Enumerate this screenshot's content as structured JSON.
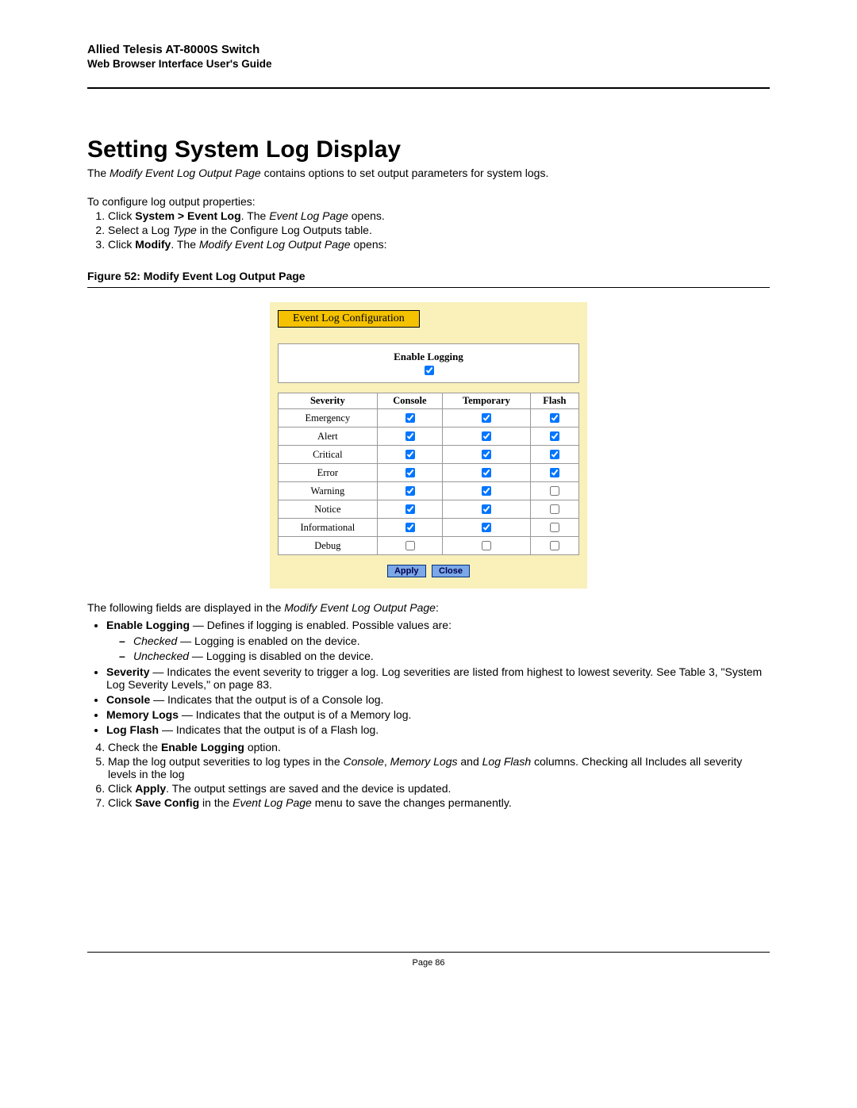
{
  "header": {
    "title": "Allied Telesis AT-8000S Switch",
    "subtitle": "Web Browser Interface User's Guide"
  },
  "section": {
    "title": "Setting System Log Display",
    "intro_prefix": "The ",
    "intro_em": "Modify Event Log Output Page",
    "intro_suffix": " contains options to set output parameters for system logs.",
    "config_lead": "To configure log output properties:"
  },
  "steps_a": {
    "s1_a": "Click ",
    "s1_b": "System > Event Log",
    "s1_c": ". The ",
    "s1_d": "Event Log Page",
    "s1_e": " opens.",
    "s2_a": "Select a Log ",
    "s2_b": "Type",
    "s2_c": " in the Configure Log Outputs table.",
    "s3_a": "Click ",
    "s3_b": "Modify",
    "s3_c": ". The ",
    "s3_d": "Modify Event Log Output Page",
    "s3_e": " opens:"
  },
  "figure": {
    "caption": "Figure 52:  Modify Event Log Output Page",
    "tab": "Event Log Configuration",
    "enable_label": "Enable Logging",
    "headers": {
      "severity": "Severity",
      "console": "Console",
      "temporary": "Temporary",
      "flash": "Flash"
    },
    "rows": [
      {
        "label": "Emergency",
        "console": true,
        "temporary": true,
        "flash": true
      },
      {
        "label": "Alert",
        "console": true,
        "temporary": true,
        "flash": true
      },
      {
        "label": "Critical",
        "console": true,
        "temporary": true,
        "flash": true
      },
      {
        "label": "Error",
        "console": true,
        "temporary": true,
        "flash": true
      },
      {
        "label": "Warning",
        "console": true,
        "temporary": true,
        "flash": false
      },
      {
        "label": "Notice",
        "console": true,
        "temporary": true,
        "flash": false
      },
      {
        "label": "Informational",
        "console": true,
        "temporary": true,
        "flash": false
      },
      {
        "label": "Debug",
        "console": false,
        "temporary": false,
        "flash": false
      }
    ],
    "buttons": {
      "apply": "Apply",
      "close": "Close"
    }
  },
  "fields_intro_a": "The following fields are displayed in the ",
  "fields_intro_b": "Modify Event Log Output Page",
  "fields_intro_c": ":",
  "bul": {
    "enable_a": "Enable Logging",
    "enable_b": " — Defines if logging is enabled. Possible values are:",
    "checked_a": "Checked",
    "checked_b": " — Logging is enabled on the device.",
    "unchecked_a": "Unchecked",
    "unchecked_b": " — Logging is disabled on the device.",
    "severity_a": "Severity",
    "severity_b": " — Indicates the event severity to trigger a log. Log severities are listed from highest to lowest severity. See Table 3, \"System Log Severity Levels,\" on page 83.",
    "console_a": "Console",
    "console_b": " — Indicates that the output is of a Console log.",
    "memory_a": "Memory Logs",
    "memory_b": " — Indicates that the output is of a Memory log.",
    "flash_a": "Log Flash",
    "flash_b": " — Indicates that the output is of a Flash log."
  },
  "steps_b": {
    "s4_a": "Check the ",
    "s4_b": "Enable Logging",
    "s4_c": " option.",
    "s5_a": "Map the log output severities to log types in the ",
    "s5_b": "Console",
    "s5_c": ", ",
    "s5_d": "Memory Logs",
    "s5_e": " and ",
    "s5_f": "Log Flash",
    "s5_g": " columns. Checking all Includes all severity levels in the log",
    "s6_a": "Click ",
    "s6_b": "Apply",
    "s6_c": ". The output settings are saved and the device is updated.",
    "s7_a": " Click ",
    "s7_b": "Save Config",
    "s7_c": " in the ",
    "s7_d": "Event Log Page",
    "s7_e": " menu to save the changes permanently."
  },
  "footer": {
    "page": "Page 86"
  }
}
